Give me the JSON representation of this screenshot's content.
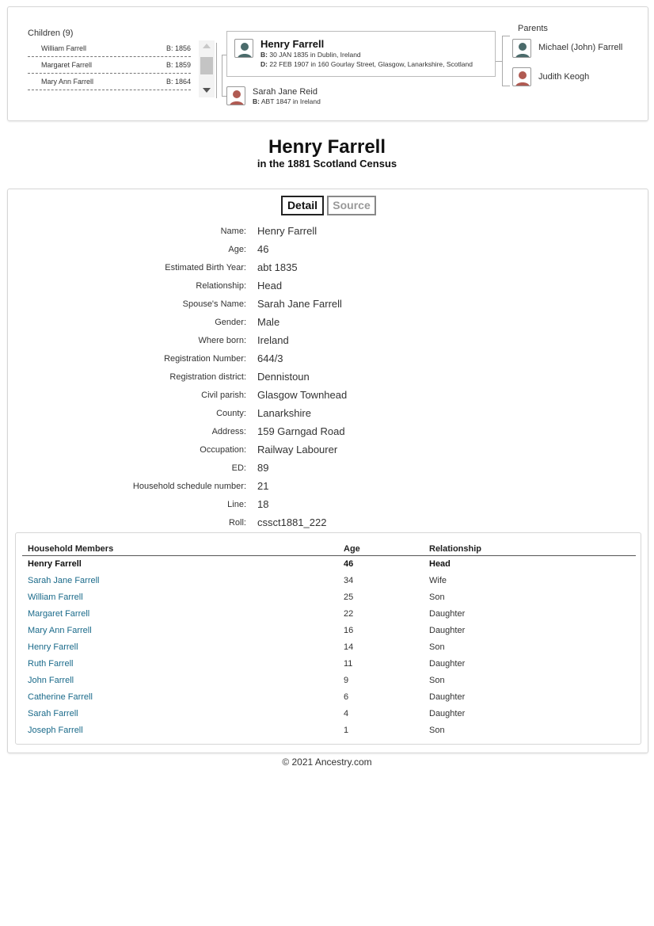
{
  "tree": {
    "children_title": "Children (9)",
    "children": [
      {
        "name": "William Farrell",
        "birth": "B: 1856"
      },
      {
        "name": "Margaret Farrell",
        "birth": "B: 1859"
      },
      {
        "name": "Mary Ann Farrell",
        "birth": "B: 1864"
      }
    ],
    "person": {
      "name": "Henry Farrell",
      "birth_label": "B:",
      "birth": "30 JAN 1835 in Dublin, Ireland",
      "death_label": "D:",
      "death": "22 FEB 1907 in 160 Gourlay Street, Glasgow, Lanarkshire, Scotland"
    },
    "spouse": {
      "name": "Sarah Jane Reid",
      "birth_label": "B:",
      "birth": "ABT 1847 in Ireland"
    },
    "parents_title": "Parents",
    "father": "Michael (John) Farrell",
    "mother": "Judith Keogh",
    "colors": {
      "male_avatar": "#4a6b6b",
      "female_avatar": "#b05a52"
    }
  },
  "heading": {
    "title": "Henry Farrell",
    "subtitle": "in the 1881 Scotland Census"
  },
  "tabs": {
    "detail": "Detail",
    "source": "Source"
  },
  "fields": [
    {
      "label": "Name:",
      "value": "Henry Farrell"
    },
    {
      "label": "Age:",
      "value": "46"
    },
    {
      "label": "Estimated Birth Year:",
      "value": "abt 1835"
    },
    {
      "label": "Relationship:",
      "value": "Head"
    },
    {
      "label": "Spouse's Name:",
      "value": "Sarah Jane Farrell"
    },
    {
      "label": "Gender:",
      "value": "Male"
    },
    {
      "label": "Where born:",
      "value": "Ireland"
    },
    {
      "label": "Registration Number:",
      "value": "644/3"
    },
    {
      "label": "Registration district:",
      "value": "Dennistoun"
    },
    {
      "label": "Civil parish:",
      "value": "Glasgow Townhead"
    },
    {
      "label": "County:",
      "value": "Lanarkshire"
    },
    {
      "label": "Address:",
      "value": "159 Garngad Road"
    },
    {
      "label": "Occupation:",
      "value": "Railway Labourer"
    },
    {
      "label": "ED:",
      "value": "89"
    },
    {
      "label": "Household schedule number:",
      "value": "21"
    },
    {
      "label": "Line:",
      "value": "18"
    },
    {
      "label": "Roll:",
      "value": "cssct1881_222"
    }
  ],
  "household": {
    "headers": {
      "name": "Household Members",
      "age": "Age",
      "relationship": "Relationship"
    },
    "members": [
      {
        "name": "Henry Farrell",
        "age": "46",
        "relationship": "Head"
      },
      {
        "name": "Sarah Jane Farrell",
        "age": "34",
        "relationship": "Wife"
      },
      {
        "name": "William Farrell",
        "age": "25",
        "relationship": "Son"
      },
      {
        "name": "Margaret Farrell",
        "age": "22",
        "relationship": "Daughter"
      },
      {
        "name": "Mary Ann Farrell",
        "age": "16",
        "relationship": "Daughter"
      },
      {
        "name": "Henry Farrell",
        "age": "14",
        "relationship": "Son"
      },
      {
        "name": "Ruth Farrell",
        "age": "11",
        "relationship": "Daughter"
      },
      {
        "name": "John Farrell",
        "age": "9",
        "relationship": "Son"
      },
      {
        "name": "Catherine Farrell",
        "age": "6",
        "relationship": "Daughter"
      },
      {
        "name": "Sarah Farrell",
        "age": "4",
        "relationship": "Daughter"
      },
      {
        "name": "Joseph Farrell",
        "age": "1",
        "relationship": "Son"
      }
    ]
  },
  "footer": {
    "copyright": "© 2021 Ancestry.com"
  }
}
